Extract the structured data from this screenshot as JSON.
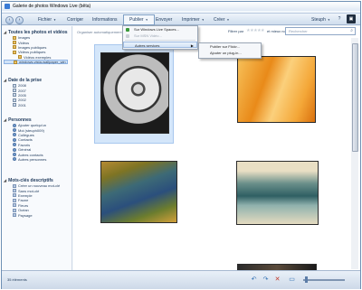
{
  "window": {
    "title": "Galerie de photos Windows Live (bêta)"
  },
  "toolbar": {
    "back_icon": "back-arrow-icon",
    "forward_icon": "forward-arrow-icon",
    "menus": [
      "Fichier",
      "Corriger",
      "Informations",
      "Publier",
      "Envoyer",
      "Imprimer",
      "Créer"
    ],
    "user": "Steuph",
    "help": "?"
  },
  "publish_menu": {
    "items": [
      {
        "label": "Sur Windows Live Spaces...",
        "enabled": true,
        "icon": "spaces-icon"
      },
      {
        "label": "Sur MSN Vidéo...",
        "enabled": false,
        "icon": "video-icon"
      },
      {
        "label": "Autres services",
        "enabled": true,
        "icon": "",
        "submenu": true
      }
    ]
  },
  "sub_menu": {
    "items": [
      "Publier sur Flickr...",
      "Ajouter un plug-in..."
    ]
  },
  "filter_bar": {
    "breadcrumb": "windows-vista-wallpaper_win",
    "sort_hint": "Organiser automatiquement",
    "rating_label": "Filtrer par",
    "rating_value": "et mieux notées"
  },
  "search": {
    "placeholder": "Rechercher"
  },
  "sidebar": {
    "library": {
      "title": "Toutes les photos et vidéos",
      "items": [
        "Images",
        "Vidéos",
        "Images publiques",
        "Vidéos publiques",
        "Vidéos exemples",
        "windows-vista-wallpaper_win"
      ]
    },
    "date": {
      "title": "Date de la prise",
      "items": [
        "2008",
        "2007",
        "2005",
        "2002",
        "2001"
      ]
    },
    "people": {
      "title": "Personnes",
      "items": [
        "Ajouter quelqu'un",
        "Moi (steuph009)",
        "Collègues",
        "Contacts",
        "Favoris",
        "Général",
        "Autres contacts",
        "Autres personnes"
      ]
    },
    "tags": {
      "title": "Mots-clés descriptifs",
      "items": [
        "Créer un nouveau mot-clé",
        "Sans mot-clé",
        "Exemple",
        "Faune",
        "Fleurs",
        "Océan",
        "Paysage"
      ]
    }
  },
  "status": {
    "count": "35 éléments",
    "zoom_level": 0.08
  },
  "colors": {
    "accent": "#3a7bd5",
    "toolbar_top": "#eef4fb",
    "toolbar_bottom": "#cfdded",
    "selection": "#d4e6fa"
  }
}
